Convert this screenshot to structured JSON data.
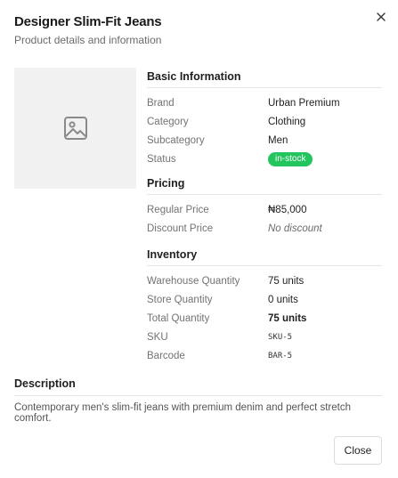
{
  "modal": {
    "title": "Designer Slim-Fit Jeans",
    "subtitle": "Product details and information",
    "close_icon": "close-icon",
    "image_icon": "image-placeholder-icon",
    "close_button_label": "Close"
  },
  "basic": {
    "title": "Basic Information",
    "brand_label": "Brand",
    "brand_value": "Urban Premium",
    "category_label": "Category",
    "category_value": "Clothing",
    "subcategory_label": "Subcategory",
    "subcategory_value": "Men",
    "status_label": "Status",
    "status_value": "in-stock"
  },
  "pricing": {
    "title": "Pricing",
    "regular_label": "Regular Price",
    "regular_value": "₦85,000",
    "discount_label": "Discount Price",
    "discount_value": "No discount"
  },
  "inventory": {
    "title": "Inventory",
    "warehouse_label": "Warehouse Quantity",
    "warehouse_value": "75 units",
    "store_label": "Store Quantity",
    "store_value": "0 units",
    "total_label": "Total Quantity",
    "total_value": "75 units",
    "sku_label": "SKU",
    "sku_value": "SKU-5",
    "barcode_label": "Barcode",
    "barcode_value": "BAR-5"
  },
  "description": {
    "title": "Description",
    "text": "Contemporary men's slim-fit jeans with premium denim and perfect stretch comfort."
  },
  "colors": {
    "status_badge": "#22c55e",
    "divider": "#e6e6e6",
    "image_bg": "#f1f1f1"
  }
}
